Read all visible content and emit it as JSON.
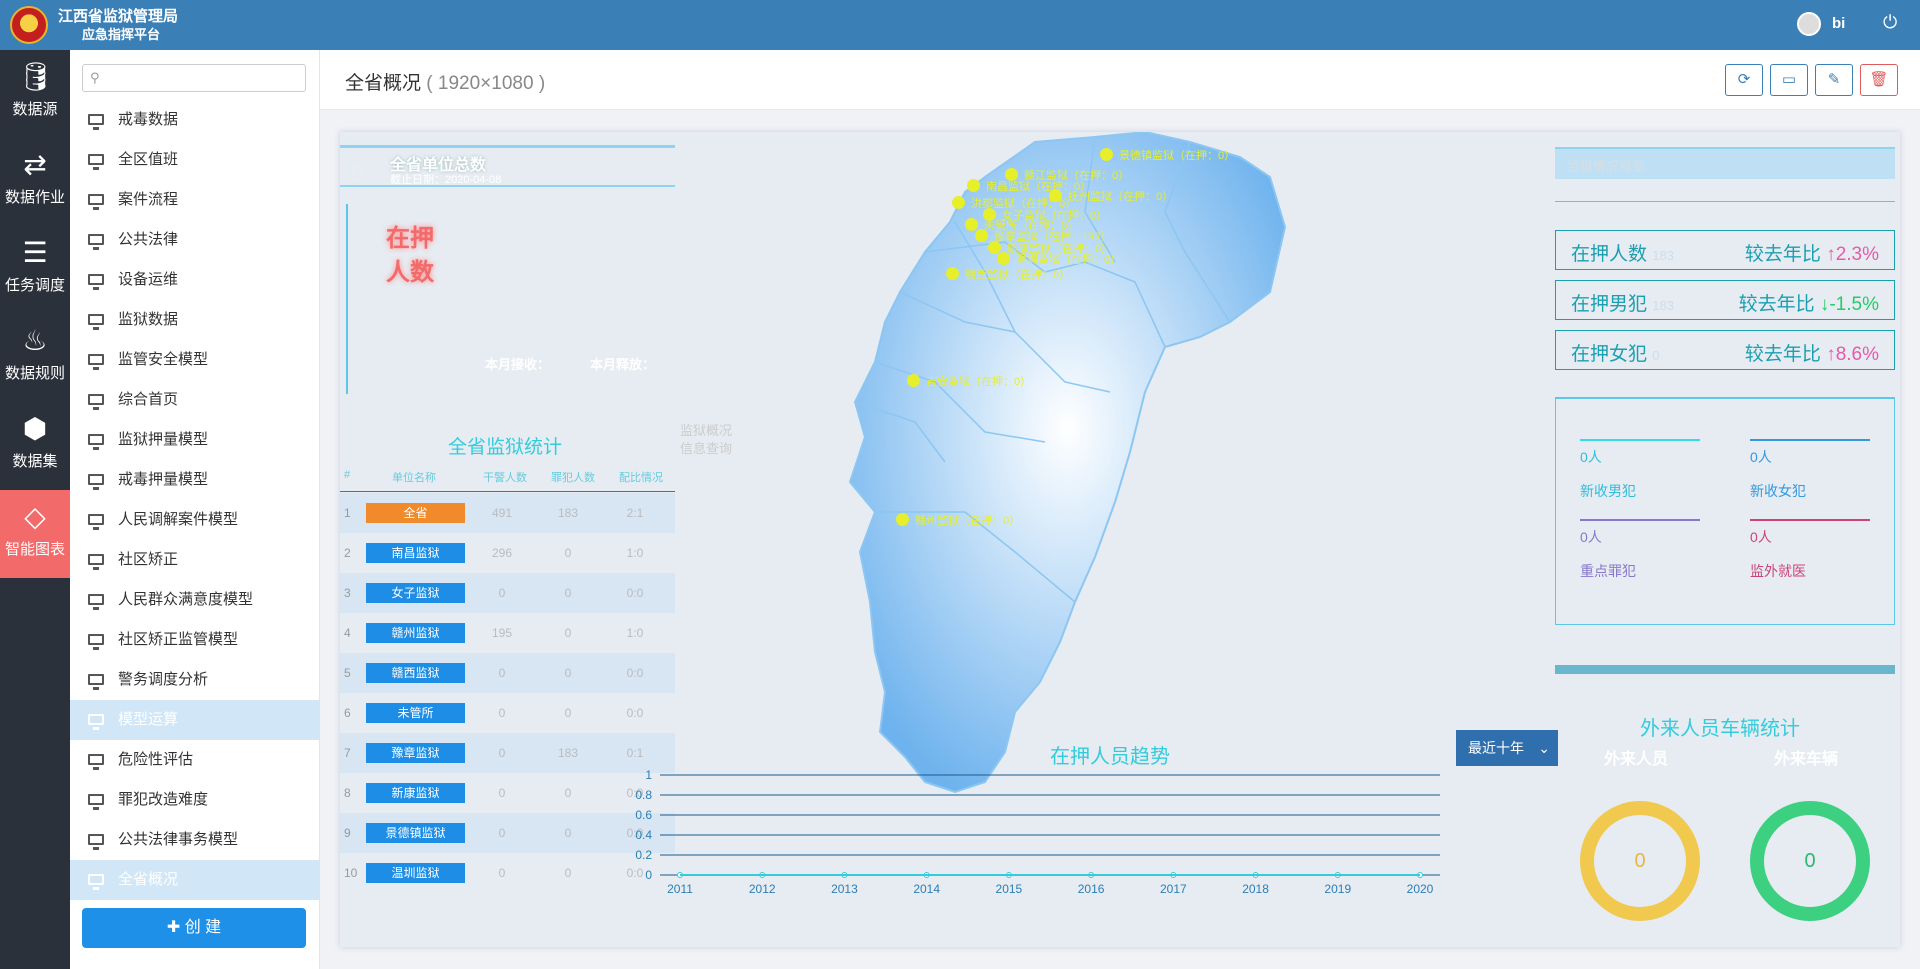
{
  "app": {
    "title_line1": "江西省监狱管理局",
    "title_line2": "应急指挥平台",
    "user": "bi"
  },
  "nav": [
    {
      "label": "数据源",
      "icon": "database-icon"
    },
    {
      "label": "数据作业",
      "icon": "sync-icon"
    },
    {
      "label": "任务调度",
      "icon": "tasks-icon"
    },
    {
      "label": "数据规则",
      "icon": "fire-icon"
    },
    {
      "label": "数据集",
      "icon": "cubes-icon"
    },
    {
      "label": "智能图表",
      "icon": "diamond-icon"
    }
  ],
  "menu": [
    "戒毒数据",
    "全区值班",
    "案件流程",
    "公共法律",
    "设备运维",
    "监狱数据",
    "监管安全模型",
    "综合首页",
    "监狱押量模型",
    "戒毒押量模型",
    "人民调解案件模型",
    "社区矫正",
    "人民群众满意度模型",
    "社区矫正监管模型",
    "警务调度分析",
    "模型运算",
    "危险性评估",
    "罪犯改造难度",
    "公共法律事务模型",
    "全省概况"
  ],
  "create_label": "✚ 创 建",
  "page": {
    "title": "全省概况",
    "size": "( 1920×1080 )"
  },
  "dash": {
    "unit_title": "全省单位总数",
    "unit_date": "截止日期：2020-04-08",
    "zaiya_label_1": "在押",
    "zaiya_label_2": "人数",
    "month_in": "本月接收：",
    "month_out": "本月释放：",
    "stat_title": "全省监狱统计",
    "cols": [
      "#",
      "单位名称",
      "干警人数",
      "罪犯人数",
      "配比情况"
    ],
    "rows": [
      [
        "1",
        "全省",
        "491",
        "183",
        "2:1"
      ],
      [
        "2",
        "南昌监狱",
        "296",
        "0",
        "1:0"
      ],
      [
        "3",
        "女子监狱",
        "0",
        "0",
        "0:0"
      ],
      [
        "4",
        "赣州监狱",
        "195",
        "0",
        "1:0"
      ],
      [
        "5",
        "赣西监狱",
        "0",
        "0",
        "0:0"
      ],
      [
        "6",
        "未管所",
        "0",
        "0",
        "0:0"
      ],
      [
        "7",
        "豫章监狱",
        "0",
        "183",
        "0:1"
      ],
      [
        "8",
        "新康监狱",
        "0",
        "0",
        "0:0"
      ],
      [
        "9",
        "景德镇监狱",
        "0",
        "0",
        "0:0"
      ],
      [
        "10",
        "温圳监狱",
        "0",
        "0",
        "0:0"
      ]
    ],
    "overview_1": "监狱概况",
    "overview_2": "信息查询",
    "cities": [
      {
        "name": "景德镇监狱（在押：0）"
      },
      {
        "name": "赣江监狱（在押：0）"
      },
      {
        "name": "南昌监狱（在押：0）"
      },
      {
        "name": "抚州监狱（在押：0）"
      },
      {
        "name": "洪都监狱（在押：0）"
      },
      {
        "name": "女子监狱（在押：0）"
      },
      {
        "name": "未管所（在押：0）"
      },
      {
        "name": "豫章监狱（在押：183）"
      },
      {
        "name": "新康监狱（在押：0）"
      },
      {
        "name": "温圳监狱（在押：0）"
      },
      {
        "name": "赣西监狱（在押：0）"
      },
      {
        "name": "吉安监狱（在押：0）"
      },
      {
        "name": "赣州监狱（在押：0）"
      }
    ],
    "situation_title": "监狱情况概览",
    "stats": [
      {
        "label": "在押人数",
        "value": "183",
        "cmp": "较去年比",
        "arrow": "↑",
        "pct": "2.3%"
      },
      {
        "label": "在押男犯",
        "value": "183",
        "cmp": "较去年比",
        "arrow": "↓",
        "pct": "-1.5%"
      },
      {
        "label": "在押女犯",
        "value": "0",
        "cmp": "较去年比",
        "arrow": "↑",
        "pct": "8.6%"
      }
    ],
    "small": [
      {
        "value": "0人",
        "label": "新收男犯"
      },
      {
        "value": "0人",
        "label": "新收女犯"
      },
      {
        "value": "0人",
        "label": "重点罪犯"
      },
      {
        "value": "0人",
        "label": "监外就医"
      }
    ],
    "trend_title": "在押人员趋势",
    "trend_select": "最近十年",
    "visitor_title": "外来人员车辆统计",
    "visitor_people": "外来人员",
    "visitor_cars": "外来车辆",
    "visitor_people_value": "0",
    "visitor_cars_value": "0",
    "colors": {
      "accent": "#33ccdd",
      "red": "#f26a6a",
      "map": "#6fb3ee"
    }
  },
  "chart_data": {
    "type": "line",
    "title": "在押人员趋势",
    "x": [
      "2011",
      "2012",
      "2013",
      "2014",
      "2015",
      "2016",
      "2017",
      "2018",
      "2019",
      "2020"
    ],
    "series": [
      {
        "values": [
          0,
          0,
          0,
          0,
          0,
          0,
          0,
          0,
          0,
          0
        ]
      }
    ],
    "ylim": [
      0,
      1
    ],
    "yticks": [
      "0",
      "0.2",
      "0.4",
      "0.6",
      "0.8",
      "1"
    ],
    "grid": true
  }
}
